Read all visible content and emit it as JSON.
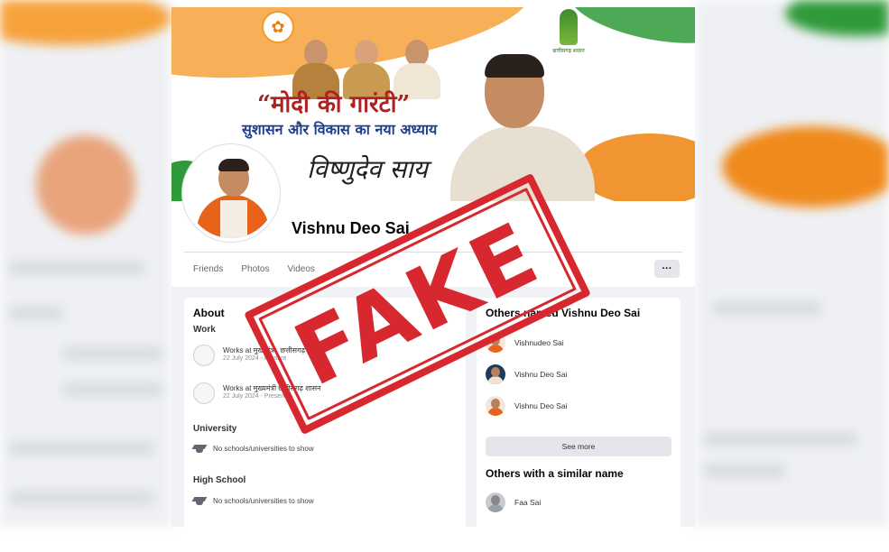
{
  "cover": {
    "slogan_line1": "“मोदी की गारंटी”",
    "slogan_line2": "सुशासन और विकास का नया अध्याय",
    "signature": "विष्णुदेव साय",
    "party_logo_icon": "lotus-icon",
    "state_logo_text": "छत्तीसगढ़ शासन"
  },
  "profile": {
    "name": "Vishnu Deo Sai",
    "tabs": [
      "Friends",
      "Photos",
      "Videos"
    ],
    "more_label": "···"
  },
  "about": {
    "title": "About",
    "work_label": "Work",
    "work": [
      {
        "line1": "Works at मुख्यमंत्री, छत्तीसगढ़",
        "line2": "22 July 2024 - Present"
      },
      {
        "line1": "Works at मुख्यमंत्री छत्तीसगढ़ शासन",
        "line2": "22 July 2024 - Present"
      }
    ],
    "university_label": "University",
    "university_value": "No schools/universities to show",
    "highschool_label": "High School",
    "highschool_value": "No schools/universities to show"
  },
  "others": {
    "title": "Others named Vishnu Deo Sai",
    "people": [
      "Vishnudeo Sai",
      "Vishnu Deo Sai",
      "Vishnu Deo Sai"
    ],
    "see_more": "See more",
    "similar_title": "Others with a similar name",
    "similar_people": [
      "Faa Sai"
    ]
  },
  "stamp": {
    "text": "FAKE",
    "color": "#d7282f"
  },
  "colors": {
    "saffron": "#f6a23b",
    "green": "#2f9a3a",
    "slogan_red": "#b11f1f",
    "slogan_blue": "#1f3f8a"
  }
}
